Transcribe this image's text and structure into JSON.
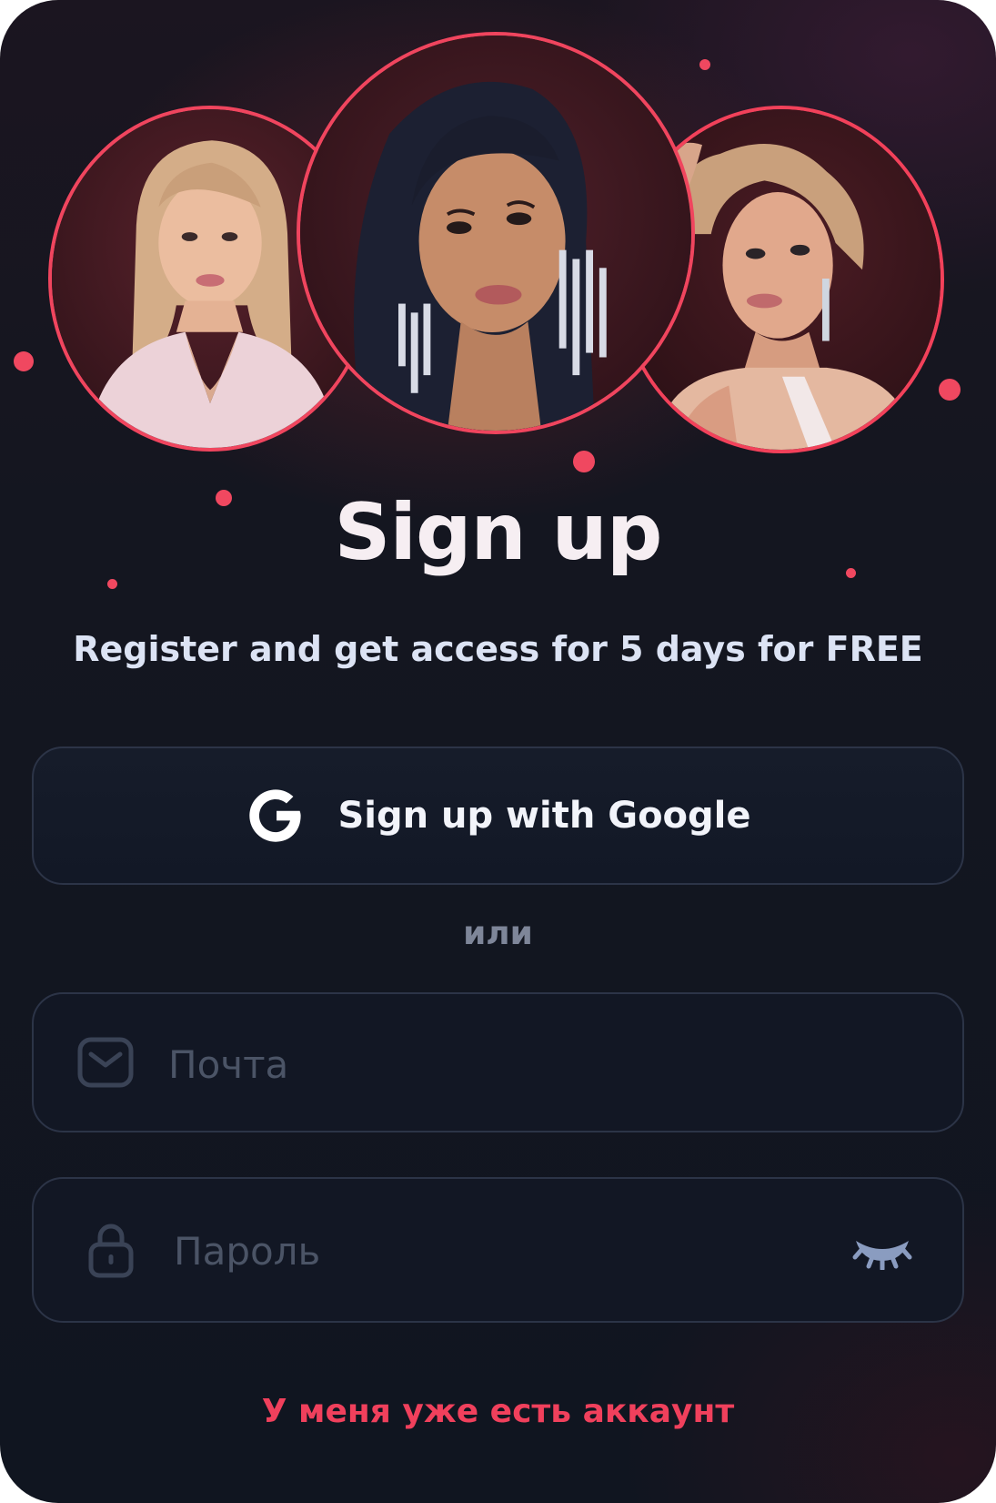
{
  "header": {
    "title": "Sign up",
    "subtitle": "Register and get access for 5 days for FREE"
  },
  "avatars": [
    {
      "name": "avatar-left",
      "hair": "#d9b28c",
      "skin": "#e8b79a",
      "bg": "#4a1d26",
      "outfit": "#e8c8d0"
    },
    {
      "name": "avatar-center",
      "hair": "#1b1e2e",
      "skin": "#c98d6a",
      "bg": "#3a1a22",
      "outfit": "#2a2030"
    },
    {
      "name": "avatar-right",
      "hair": "#caa27e",
      "skin": "#e0a98e",
      "bg": "#3b1a20",
      "outfit": "#f2e6e6"
    }
  ],
  "google": {
    "label": "Sign up with Google",
    "icon": "google-g-icon"
  },
  "divider": {
    "label": "или"
  },
  "email": {
    "placeholder": "Почта",
    "value": "",
    "icon": "mail-icon"
  },
  "password": {
    "placeholder": "Пароль",
    "value": "",
    "icon": "lock-icon",
    "toggle_icon": "closed-eye-icon"
  },
  "footer": {
    "login_link": "У меня уже есть аккаунт"
  },
  "colors": {
    "accent": "#f0455e",
    "background": "#121724",
    "field_border": "#2c3447",
    "placeholder": "#4b5466",
    "eye_icon": "#8a9cc0"
  }
}
